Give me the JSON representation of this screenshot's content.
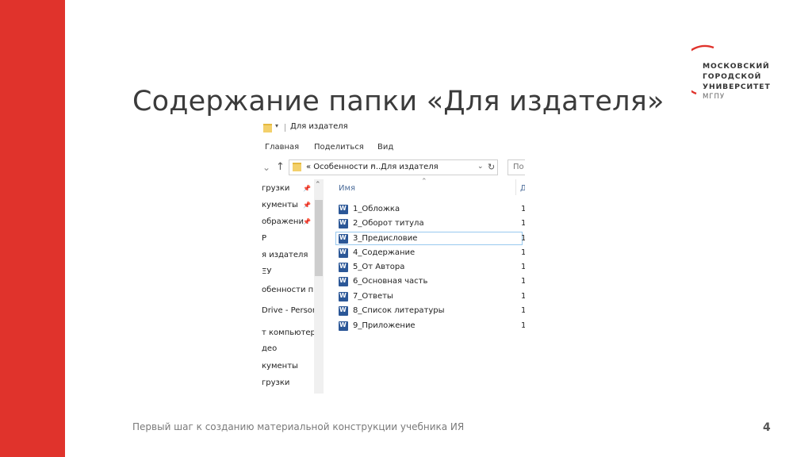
{
  "slide": {
    "title": "Содержание папки «Для издателя»",
    "footer": "Первый шаг к созданию материальной конструкции учебника ИЯ",
    "page_number": "4",
    "accent_color": "#e0332c"
  },
  "logo": {
    "line1": "МОСКОВСКИЙ",
    "line2": "ГОРОДСКОЙ",
    "line3": "УНИВЕРСИТЕТ",
    "line4": "МГПУ"
  },
  "explorer": {
    "window_title": "Для издателя",
    "ribbon": [
      "Главная",
      "Поделиться",
      "Вид"
    ],
    "address": {
      "crumb1": "« Особенности п...",
      "crumb2": "Для издателя"
    },
    "search_placeholder": "По",
    "nav_items": [
      "грузки",
      "кументы",
      "ображени",
      "P",
      "я издателя",
      "ΞУ",
      "обенности пр",
      "Drive - Persor",
      "т компьютер",
      "део",
      "кументы",
      "грузки"
    ],
    "column_name": "Имя",
    "column_date": "Д",
    "files": [
      {
        "name": "1_Обложка",
        "date": "1"
      },
      {
        "name": "2_Оборот титула",
        "date": "1"
      },
      {
        "name": "3_Предисловие",
        "date": "1"
      },
      {
        "name": "4_Содержание",
        "date": "1"
      },
      {
        "name": "5_От Автора",
        "date": "1"
      },
      {
        "name": "6_Основная часть",
        "date": "1"
      },
      {
        "name": "7_Ответы",
        "date": "1"
      },
      {
        "name": "8_Список литературы",
        "date": "1"
      },
      {
        "name": "9_Приложение",
        "date": "1"
      }
    ]
  }
}
